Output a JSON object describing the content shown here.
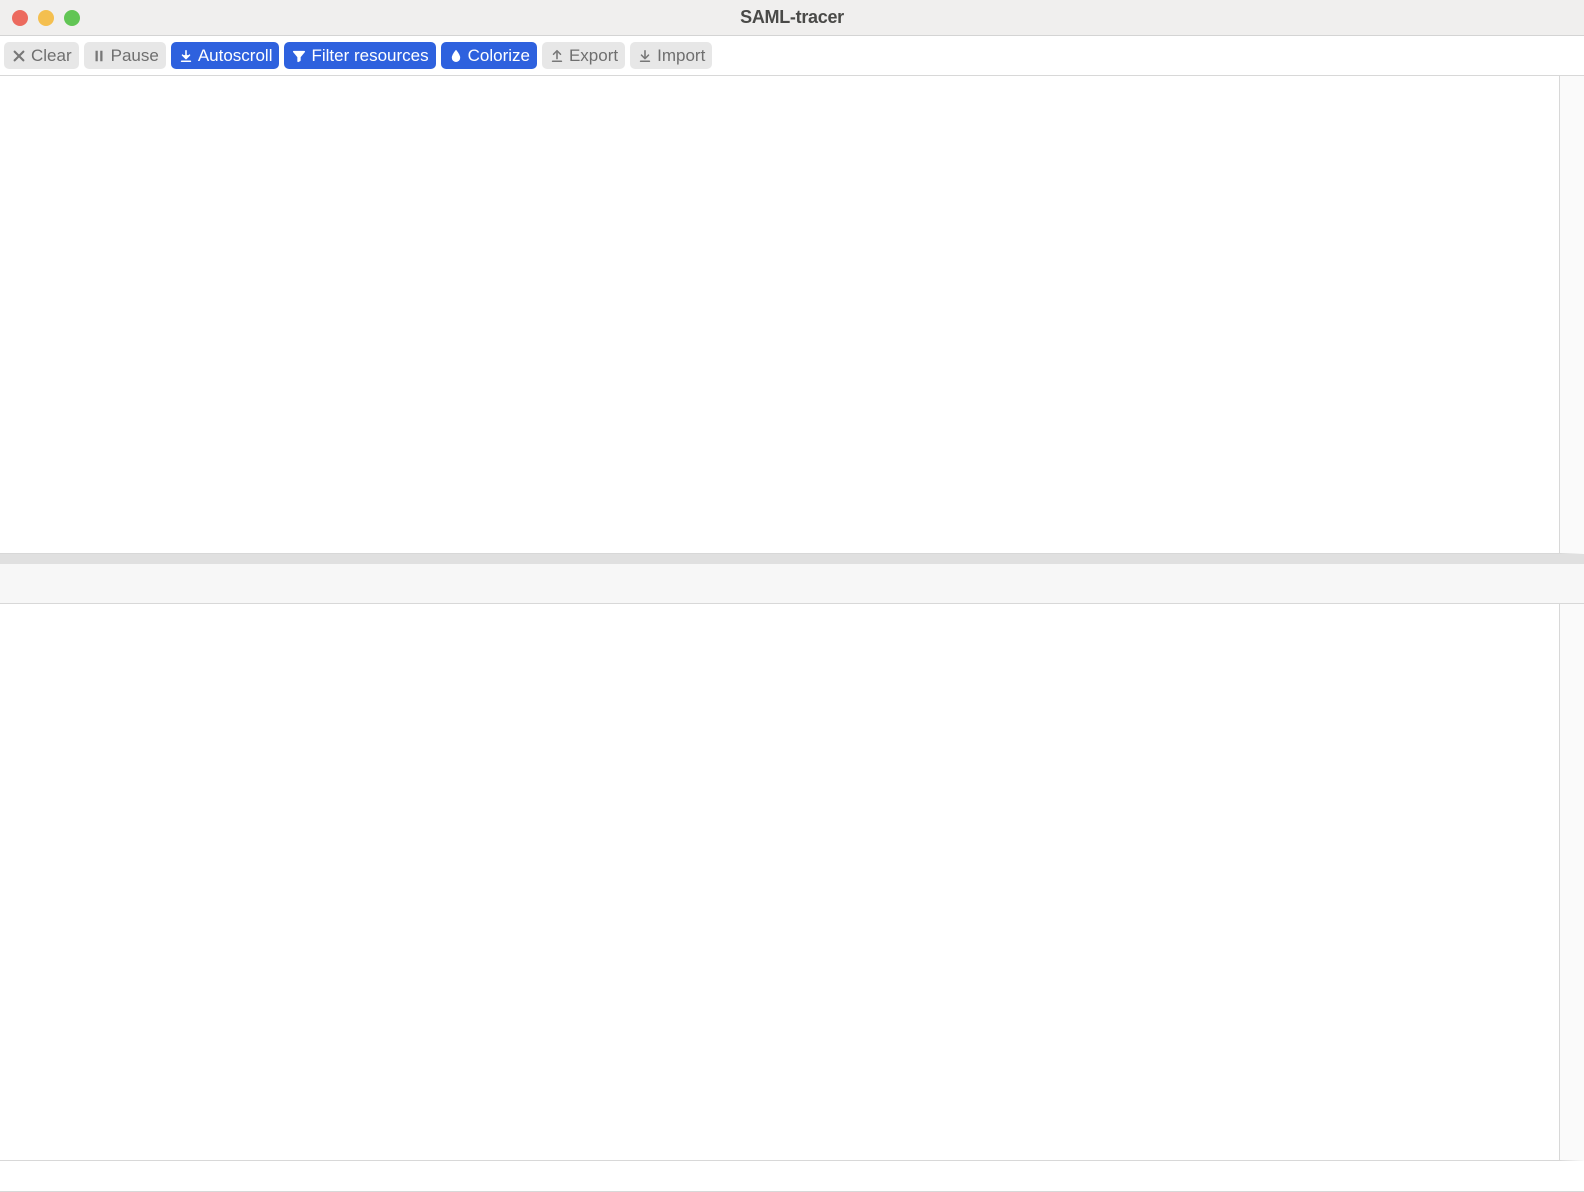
{
  "window": {
    "title": "SAML-tracer"
  },
  "toolbar": {
    "buttons": [
      {
        "id": "clear",
        "label": "Clear",
        "icon": "x-icon",
        "active": false
      },
      {
        "id": "pause",
        "label": "Pause",
        "icon": "pause-icon",
        "active": false
      },
      {
        "id": "autoscroll",
        "label": "Autoscroll",
        "icon": "download-icon",
        "active": true
      },
      {
        "id": "filter",
        "label": "Filter resources",
        "icon": "funnel-icon",
        "active": true
      },
      {
        "id": "colorize",
        "label": "Colorize",
        "icon": "droplet-icon",
        "active": true
      },
      {
        "id": "export",
        "label": "Export",
        "icon": "upload-icon",
        "active": false
      },
      {
        "id": "import",
        "label": "Import",
        "icon": "import-icon",
        "active": false
      }
    ]
  }
}
